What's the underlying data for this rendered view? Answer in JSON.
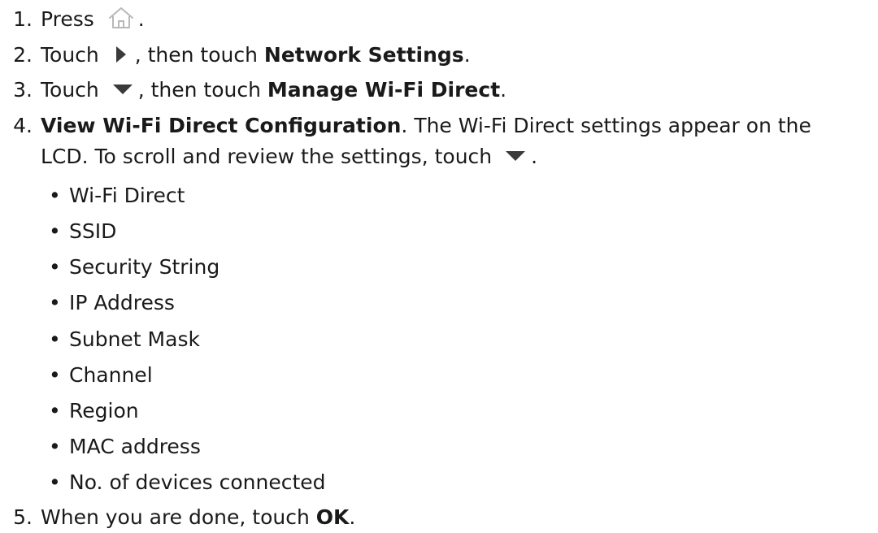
{
  "steps": [
    {
      "num": "1.",
      "pre": "Press",
      "post": "."
    },
    {
      "num": "2.",
      "pre": "Touch",
      "mid": ", then touch",
      "bold": "Network Settings",
      "post": "."
    },
    {
      "num": "3.",
      "pre": "Touch",
      "mid": ", then touch",
      "bold": "Manage Wi-Fi Direct",
      "post": "."
    },
    {
      "num": "4.",
      "bold": "View Wi-Fi Direct Configuration",
      "post": ". The Wi-Fi Direct settings appear on the",
      "line2": "LCD. To scroll and review the settings, touch",
      "line2_post": "."
    },
    {
      "num": "5.",
      "pre": "When you are done, touch",
      "bold": "OK",
      "post": "."
    }
  ],
  "bullet_char": "•",
  "settings_list": [
    "Wi-Fi Direct",
    "SSID",
    "Security String",
    "IP Address",
    "Subnet Mask",
    "Channel",
    "Region",
    "MAC address",
    "No. of devices connected"
  ],
  "icons": {
    "home": "home-icon",
    "right": "right-triangle-icon",
    "down": "down-triangle-icon"
  },
  "colors": {
    "text": "#1a1a1a",
    "icon_outline": "#b8b8b8",
    "icon_fill": "#3a3a3a"
  }
}
